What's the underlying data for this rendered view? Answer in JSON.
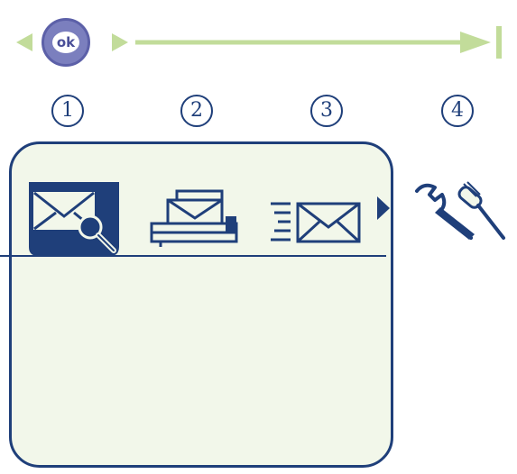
{
  "navigation": {
    "ok_label": "ok",
    "colors": {
      "track": "#c2dc9a",
      "ok_button": "#7b7fbe"
    }
  },
  "steps": [
    {
      "label": "1"
    },
    {
      "label": "2"
    },
    {
      "label": "3"
    },
    {
      "label": "4"
    }
  ],
  "screen": {
    "colors": {
      "background": "#f2f7ea",
      "ink": "#1f3f7a"
    },
    "menu_icons": [
      {
        "icon": "read-message-icon",
        "selected": true
      },
      {
        "icon": "send-message-icon",
        "selected": false
      },
      {
        "icon": "incoming-message-icon",
        "selected": false
      }
    ],
    "scroll_indicator": "right-arrow-icon"
  },
  "settings_icon": "wrench-screwdriver-icon"
}
